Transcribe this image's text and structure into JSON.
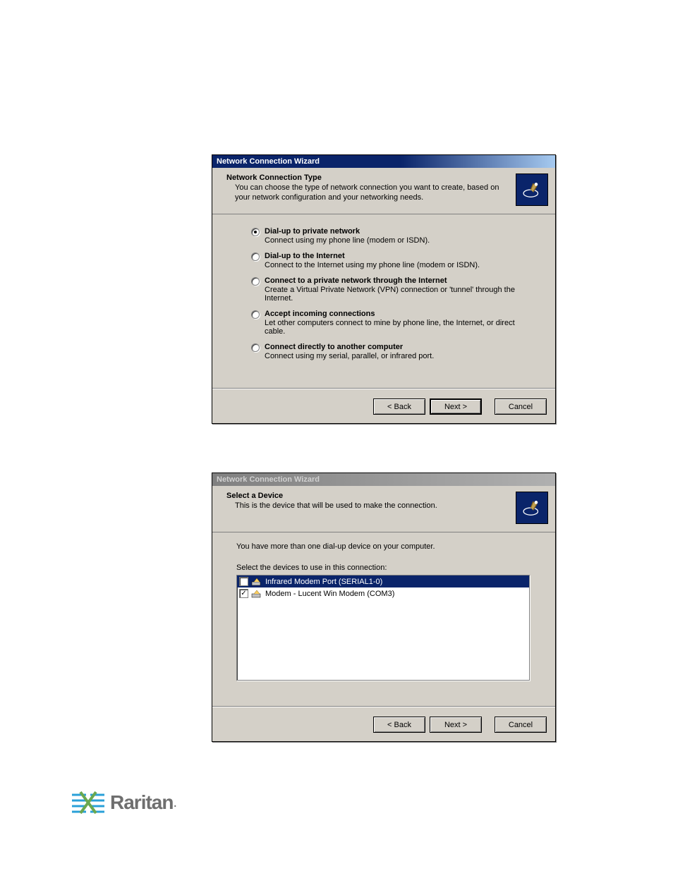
{
  "dialog1": {
    "title": "Network Connection Wizard",
    "header_title": "Network Connection Type",
    "header_sub": "You can choose the type of network connection you want to create, based on your network configuration and your networking needs.",
    "options": [
      {
        "label": "Dial-up to private network",
        "desc": "Connect using my phone line (modem or ISDN).",
        "selected": true
      },
      {
        "label": "Dial-up to the Internet",
        "desc": "Connect to the Internet using my phone line (modem or ISDN).",
        "selected": false
      },
      {
        "label": "Connect to a private network through the Internet",
        "desc": "Create a Virtual Private Network (VPN) connection or 'tunnel' through the Internet.",
        "selected": false
      },
      {
        "label": "Accept incoming connections",
        "desc": "Let other computers connect to mine by phone line, the Internet, or direct cable.",
        "selected": false
      },
      {
        "label": "Connect directly to another computer",
        "desc": "Connect using my serial, parallel, or infrared port.",
        "selected": false
      }
    ],
    "buttons": {
      "back": "< Back",
      "next": "Next >",
      "cancel": "Cancel"
    }
  },
  "dialog2": {
    "title": "Network Connection Wizard",
    "header_title": "Select a Device",
    "header_sub": "This is the device that will be used to make the connection.",
    "intro": "You have more than one dial-up device on your computer.",
    "list_label": "Select the devices to use in this connection:",
    "items": [
      {
        "label": "Infrared Modem Port (SERIAL1-0)",
        "checked": false,
        "selected": true
      },
      {
        "label": "Modem - Lucent Win Modem (COM3)",
        "checked": true,
        "selected": false
      }
    ],
    "buttons": {
      "back": "< Back",
      "next": "Next >",
      "cancel": "Cancel"
    }
  },
  "brand": "Raritan"
}
